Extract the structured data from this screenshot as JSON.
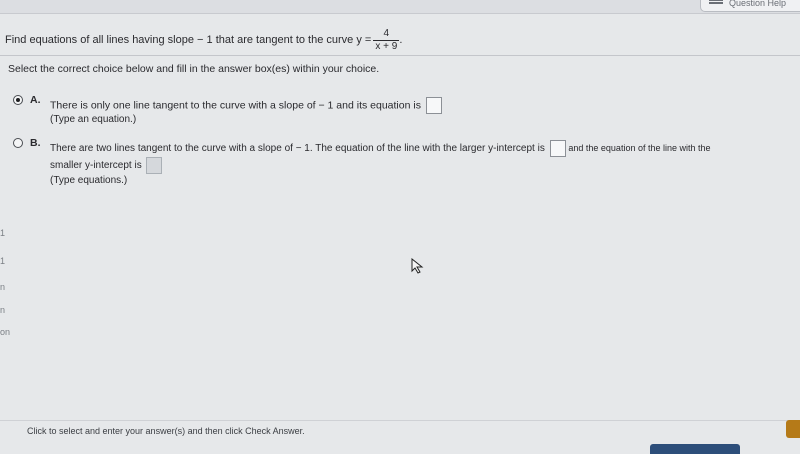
{
  "header": {
    "help_label": "Question Help"
  },
  "question": {
    "prefix": "Find equations of all lines having slope",
    "slope": "− 1",
    "middle": "that are tangent to the curve y =",
    "numerator": "4",
    "denominator": "x + 9",
    "suffix": "."
  },
  "instruction": "Select the correct choice below and fill in the answer box(es) within your choice.",
  "choices": [
    {
      "letter": "A.",
      "text": "There is only one line tangent to the curve with a slope of − 1 and its equation is",
      "hint": "(Type an equation.)",
      "selected": true
    },
    {
      "letter": "B.",
      "text_part1": "There are two lines tangent to the curve with a slope of − 1. The equation of the line with the larger y-intercept is",
      "text_part2": "and the equation of the line with the",
      "text_part3": "smaller y-intercept is",
      "hint": "(Type equations.)",
      "selected": false
    }
  ],
  "left_margin_fragments": [
    "1",
    "1",
    "n",
    "n",
    "on"
  ],
  "footer": {
    "instruction": "Click to select and enter your answer(s) and then click Check Answer."
  },
  "colors": {
    "background": "#e6e8ea",
    "check_button": "#2d4e7a",
    "corner_button": "#b57a18"
  }
}
